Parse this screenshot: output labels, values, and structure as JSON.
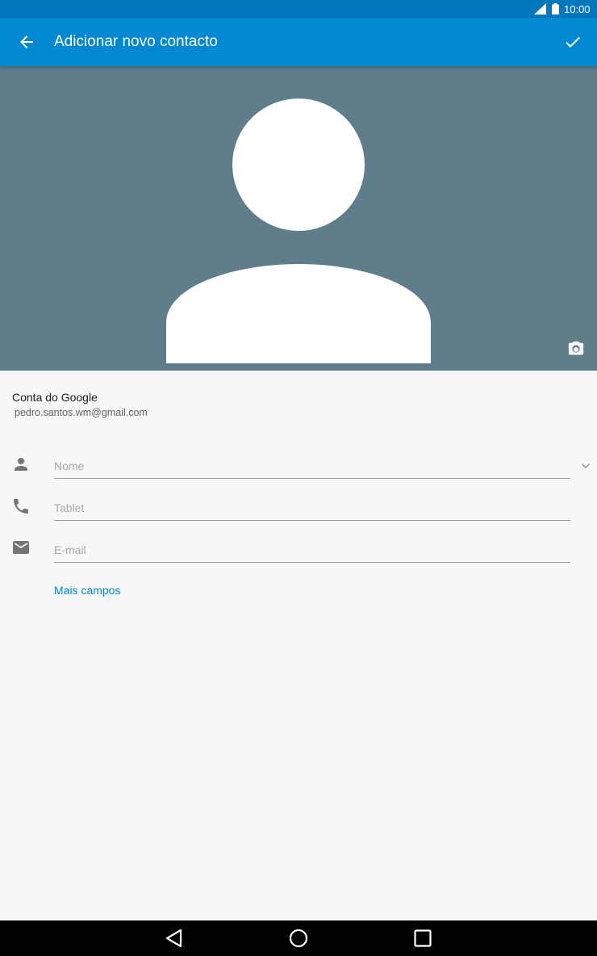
{
  "status_bar": {
    "time": "10:00",
    "icons": [
      "signal-icon",
      "battery-icon"
    ]
  },
  "app_bar": {
    "title": "Adicionar novo contacto",
    "back_icon": "arrow-back-icon",
    "save_icon": "check-icon"
  },
  "photo": {
    "background_color": "#607d8b",
    "placeholder_icon": "person-silhouette",
    "camera_icon": "camera-icon"
  },
  "account": {
    "name": "Conta do Google",
    "email": "pedro.santos.wm@gmail.com"
  },
  "form": {
    "fields": [
      {
        "icon": "person-icon",
        "placeholder": "Nome",
        "value": ""
      },
      {
        "icon": "phone-icon",
        "placeholder": "Tablet",
        "value": ""
      },
      {
        "icon": "email-icon",
        "placeholder": "E-mail",
        "value": ""
      }
    ],
    "more_fields_label": "Mais campos"
  },
  "nav_bar": {
    "buttons": [
      "back-nav-icon",
      "home-nav-icon",
      "recents-nav-icon"
    ]
  },
  "colors": {
    "status_bar": "#0277bd",
    "app_bar": "#0288d1",
    "link": "#0288d1",
    "page_background": "#f7f7f7"
  }
}
